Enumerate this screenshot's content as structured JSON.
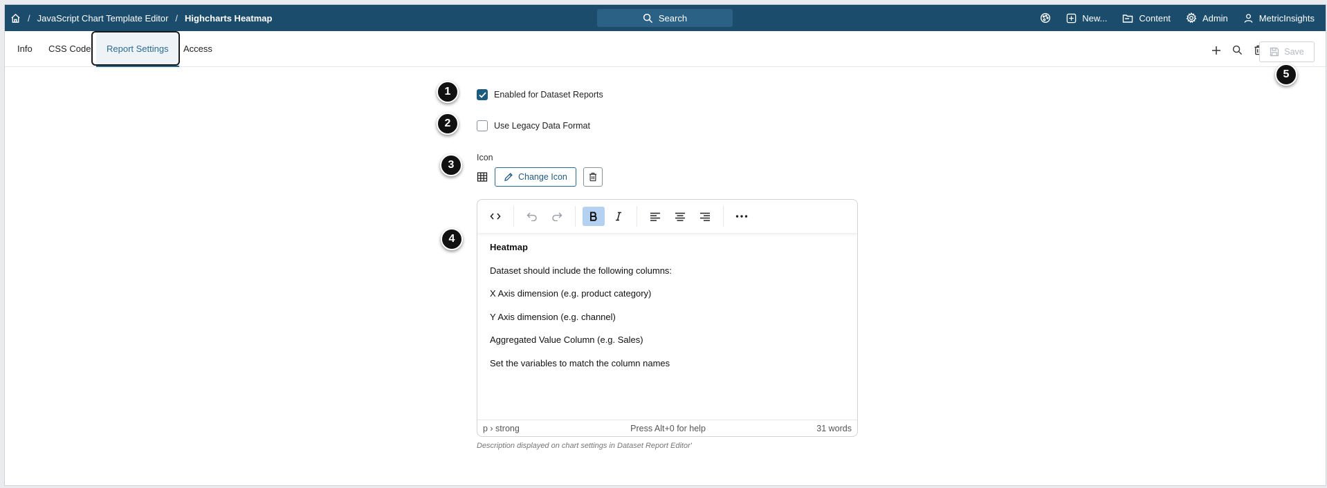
{
  "breadcrumb": {
    "separator": "/",
    "items": [
      "JavaScript Chart Template Editor",
      "Highcharts Heatmap"
    ]
  },
  "search": {
    "label": "Search"
  },
  "top_nav": {
    "new_label": "New...",
    "content_label": "Content",
    "admin_label": "Admin",
    "user_label": "MetricInsights"
  },
  "tabs": [
    {
      "label": "Info"
    },
    {
      "label": "CSS Code"
    },
    {
      "label": "Report Settings",
      "active": true
    },
    {
      "label": "Access"
    }
  ],
  "toolbar": {
    "save_label": "Save",
    "save_enabled": false
  },
  "callouts": [
    "1",
    "2",
    "3",
    "4",
    "5"
  ],
  "settings": {
    "enabled_for_dataset_reports": {
      "label": "Enabled for Dataset Reports",
      "checked": true
    },
    "use_legacy_data_format": {
      "label": "Use Legacy Data Format",
      "checked": false
    },
    "icon": {
      "label": "Icon",
      "current_icon": "table-grid-icon",
      "change_label": "Change Icon"
    }
  },
  "editor": {
    "bold_active": true,
    "content": [
      "Heatmap",
      "Dataset should include the following columns:",
      "X Axis dimension (e.g. product category)",
      "Y Axis dimension (e.g. channel)",
      "Aggregated Value Column (e.g. Sales)",
      "Set the variables to match the column names"
    ],
    "status_path": "p › strong",
    "status_help": "Press Alt+0 for help",
    "status_words": "31 words"
  },
  "description_hint": "Description displayed on chart settings in Dataset Report Editor'",
  "colors": {
    "topbar": "#1b4c6b",
    "accent": "#2b6a90",
    "checkbox_checked": "#1f5a7f",
    "bold_active_bg": "#b4d1f2"
  }
}
